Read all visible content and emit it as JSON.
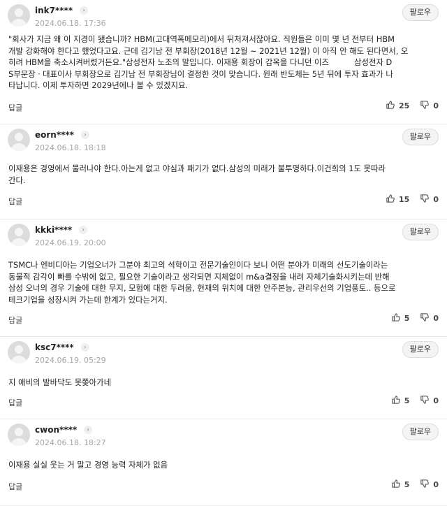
{
  "labels": {
    "follow": "팔로우",
    "reply": "답글",
    "info_icon": "›"
  },
  "comments": [
    {
      "username": "ink7****",
      "timestamp": "2024.06.18. 17:36",
      "lines": [
        "\"회사가 지금 왜 이 지경이 됐습니까? HBM(고대역폭메모리)에서 뒤처져서잖아요. 직원들은 이미 몇 년 전부터 HBM",
        "개발 강화해야 한다고 했었다고요. 근데 김기남 전 부회장(2018년 12월 ~ 2021년 12월) 이 아직 안 해도 된다면서, 오",
        "히려 HBM을 축소시켜버렸거든요.\"삼성전자 노조의 말입니다. 이재용 회장이 감옥을 다니던 이즈",
        "S부문장ㆍ대표이사 부회장으로 김기남 전 부회장님이 결정한 것이 맞습니다. 원래 반도체는 5년 뒤에 투자 효과가 나",
        "타납니다. 이제 투자하면 2029년에나 볼 수 있겠지요."
      ],
      "redacted_tail": "삼성전자 D",
      "likes": "25",
      "dislikes": "0"
    },
    {
      "username": "eorn****",
      "timestamp": "2024.06.18. 18:18",
      "lines": [
        "이재용은 경영에서 물러나야 한다.아는게 없고 야심과 패기가 없다.삼성의 미래가 불투명하다.이건희의 1도 못따라",
        "간다."
      ],
      "likes": "15",
      "dislikes": "0"
    },
    {
      "username": "kkki****",
      "timestamp": "2024.06.19. 20:00",
      "lines": [
        "TSMC나 엔비디아는 기업오너가 그분야 최고의 석학이고 전문기술인이다 보니 어떤 분야가 미래의 선도기술이라는",
        "동물적 감각이 빠를 수밖에 없고, 필요한 기술이라고 생각되면 지체없이 m&a결정을 내려 자체기술화시키는데 반해",
        "삼성 오너의 경우 기술에 대한 무지, 모험에 대한 두려움, 현재의 위치에 대한 안주본능, 관리우선의 기업풍토.. 등으로",
        "테크기업을 성장시켜 가는데 한계가 있다는거지."
      ],
      "likes": "5",
      "dislikes": "0"
    },
    {
      "username": "ksc7****",
      "timestamp": "2024.06.19. 05:29",
      "lines": [
        "지 애비의 발바닥도 못쫒아가네"
      ],
      "likes": "5",
      "dislikes": "0"
    },
    {
      "username": "cwon****",
      "timestamp": "2024.06.18. 18:27",
      "lines": [
        "이재용 실실 웃는 거 말고 경영 능력 자체가 없음"
      ],
      "likes": "5",
      "dislikes": "0"
    }
  ]
}
